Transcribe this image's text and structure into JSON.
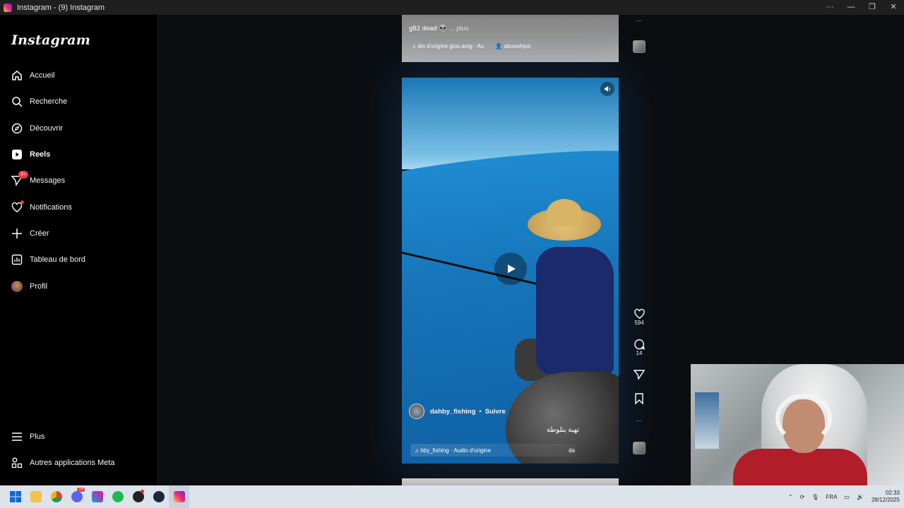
{
  "window": {
    "title": "Instagram - (9) Instagram"
  },
  "sidebar": {
    "logo": "Instagram",
    "items": [
      {
        "label": "Accueil",
        "icon": "home-icon"
      },
      {
        "label": "Recherche",
        "icon": "search-icon"
      },
      {
        "label": "Découvrir",
        "icon": "compass-icon"
      },
      {
        "label": "Reels",
        "icon": "reels-icon"
      },
      {
        "label": "Messages",
        "icon": "messages-icon",
        "badge": "9+"
      },
      {
        "label": "Notifications",
        "icon": "heart-icon"
      },
      {
        "label": "Créer",
        "icon": "plus-icon"
      },
      {
        "label": "Tableau de bord",
        "icon": "dashboard-icon"
      },
      {
        "label": "Profil",
        "icon": "avatar"
      }
    ],
    "bottom": [
      {
        "label": "Plus",
        "icon": "menu-icon"
      },
      {
        "label": "Autres applications Meta",
        "icon": "meta-apps-icon"
      }
    ]
  },
  "prev_reel": {
    "caption": "g82 dead 👽",
    "more": "... plus",
    "audio": "dio d'origine  gios.amg · Au",
    "tagged": "aboswhips"
  },
  "reel": {
    "username": "dahby_fishing",
    "separator": "•",
    "follow": "Suivre",
    "overlay_text": "تهبة بتلوطة",
    "audio": "hby_fishing · Audio d'origine",
    "audio_tail": "da"
  },
  "actions": {
    "likes": "594",
    "comments": "14"
  },
  "taskbar": {
    "lang": "FRA",
    "time": "02:33",
    "date": "28/12/2025",
    "discord_badge": "24"
  }
}
